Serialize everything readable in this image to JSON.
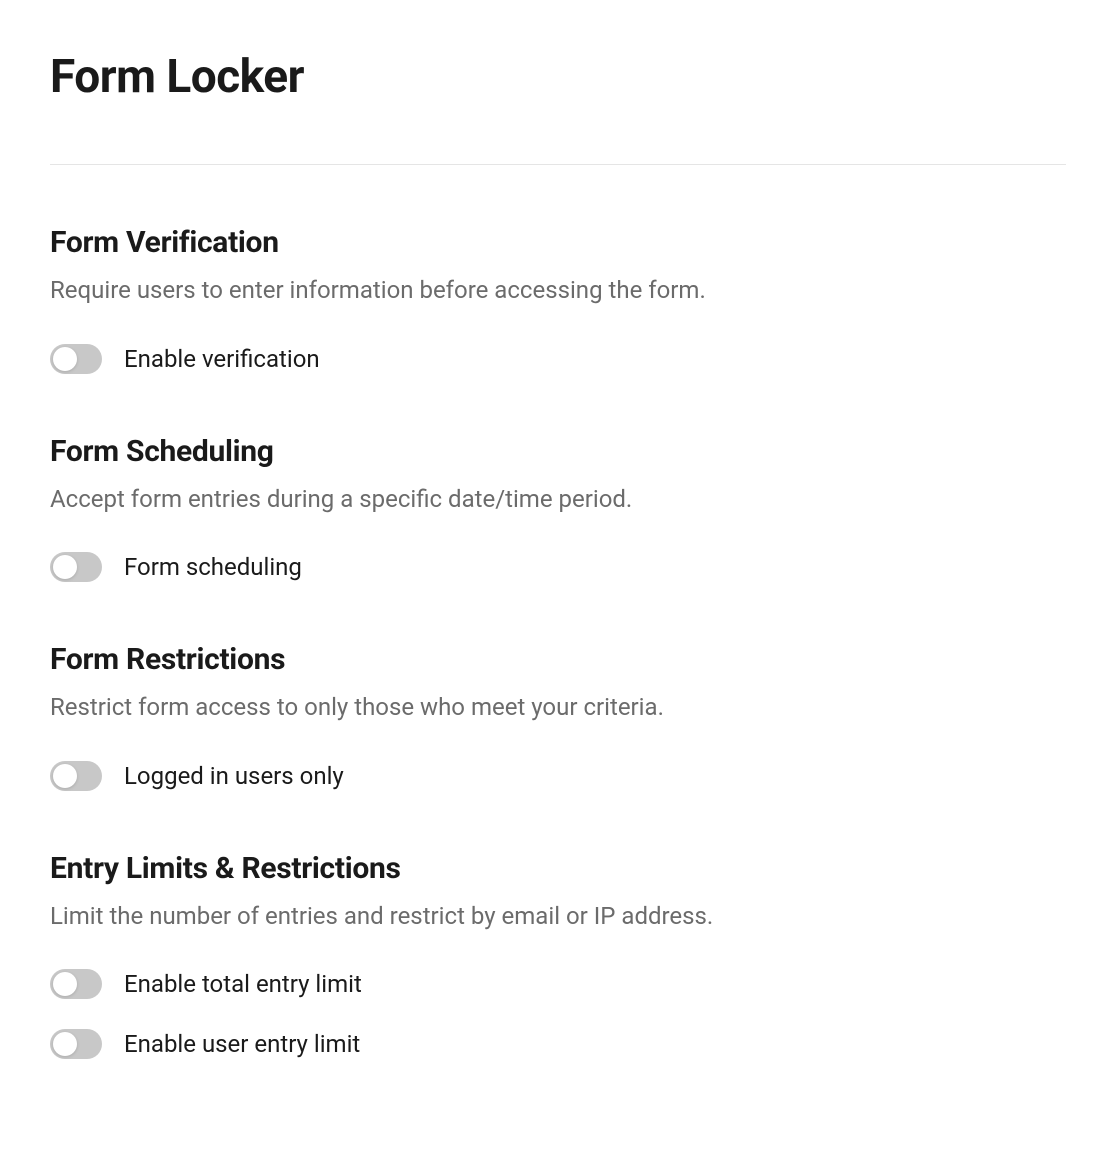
{
  "page": {
    "title": "Form Locker"
  },
  "sections": {
    "verification": {
      "title": "Form Verification",
      "description": "Require users to enter information before accessing the form.",
      "toggles": {
        "enable_verification": {
          "label": "Enable verification",
          "enabled": false
        }
      }
    },
    "scheduling": {
      "title": "Form Scheduling",
      "description": "Accept form entries during a specific date/time period.",
      "toggles": {
        "form_scheduling": {
          "label": "Form scheduling",
          "enabled": false
        }
      }
    },
    "restrictions": {
      "title": "Form Restrictions",
      "description": "Restrict form access to only those who meet your criteria.",
      "toggles": {
        "logged_in_only": {
          "label": "Logged in users only",
          "enabled": false
        }
      }
    },
    "entry_limits": {
      "title": "Entry Limits & Restrictions",
      "description": "Limit the number of entries and restrict by email or IP address.",
      "toggles": {
        "total_entry_limit": {
          "label": "Enable total entry limit",
          "enabled": false
        },
        "user_entry_limit": {
          "label": "Enable user entry limit",
          "enabled": false
        }
      }
    }
  }
}
